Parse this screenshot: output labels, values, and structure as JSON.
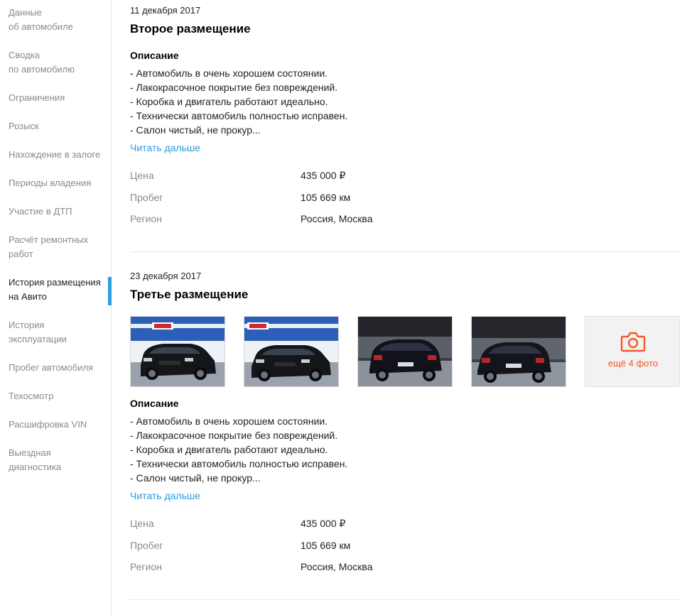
{
  "sidebar": {
    "items": [
      {
        "line1": "Данные",
        "line2": "об автомобиле"
      },
      {
        "line1": "Сводка",
        "line2": "по автомобилю"
      },
      {
        "line1": "Ограничения",
        "line2": ""
      },
      {
        "line1": "Розыск",
        "line2": ""
      },
      {
        "line1": "Нахождение в залоге",
        "line2": ""
      },
      {
        "line1": "Периоды владения",
        "line2": ""
      },
      {
        "line1": "Участие в ДТП",
        "line2": ""
      },
      {
        "line1": "Расчёт ремонтных",
        "line2": "работ"
      },
      {
        "line1": "История размещения",
        "line2": "на Авито"
      },
      {
        "line1": "История",
        "line2": "эксплуатации"
      },
      {
        "line1": "Пробег автомобиля",
        "line2": ""
      },
      {
        "line1": "Техосмотр",
        "line2": ""
      },
      {
        "line1": "Расшифровка VIN",
        "line2": ""
      },
      {
        "line1": "Выездная",
        "line2": "диагностика"
      }
    ],
    "active_index": 8,
    "accent_color": "#2a9de0"
  },
  "placements": [
    {
      "date": "11 декабря 2017",
      "title": "Второе размещение",
      "description_title": "Описание",
      "description": [
        "- Автомобиль в очень хорошем состоянии.",
        "- Лакокрасочное покрытие без повреждений.",
        "- Коробка и двигатель работают идеально.",
        "- Технически автомобиль полностью исправен.",
        "- Салон чистый, не прокур..."
      ],
      "read_more": "Читать дальше",
      "props": {
        "price_label": "Цена",
        "price_value": "435 000 ₽",
        "mileage_label": "Пробег",
        "mileage_value": "105 669 км",
        "region_label": "Регион",
        "region_value": "Россия, Москва"
      }
    },
    {
      "date": "23 декабря 2017",
      "title": "Третье размещение",
      "photos": [
        "car-front-photo",
        "car-front-photo",
        "car-rear-photo",
        "car-rear-photo"
      ],
      "more_photos": "ещё 4 фото",
      "description_title": "Описание",
      "description": [
        "- Автомобиль в очень хорошем состоянии.",
        "- Лакокрасочное покрытие без повреждений.",
        "- Коробка и двигатель работают идеально.",
        "- Технически автомобиль полностью исправен.",
        "- Салон чистый, не прокур..."
      ],
      "read_more": "Читать дальше",
      "props": {
        "price_label": "Цена",
        "price_value": "435 000 ₽",
        "mileage_label": "Пробег",
        "mileage_value": "105 669 км",
        "region_label": "Регион",
        "region_value": "Россия, Москва"
      }
    }
  ],
  "colors": {
    "link": "#2a9de0",
    "more_photos": "#f05a28",
    "muted": "#8a8a8a"
  }
}
